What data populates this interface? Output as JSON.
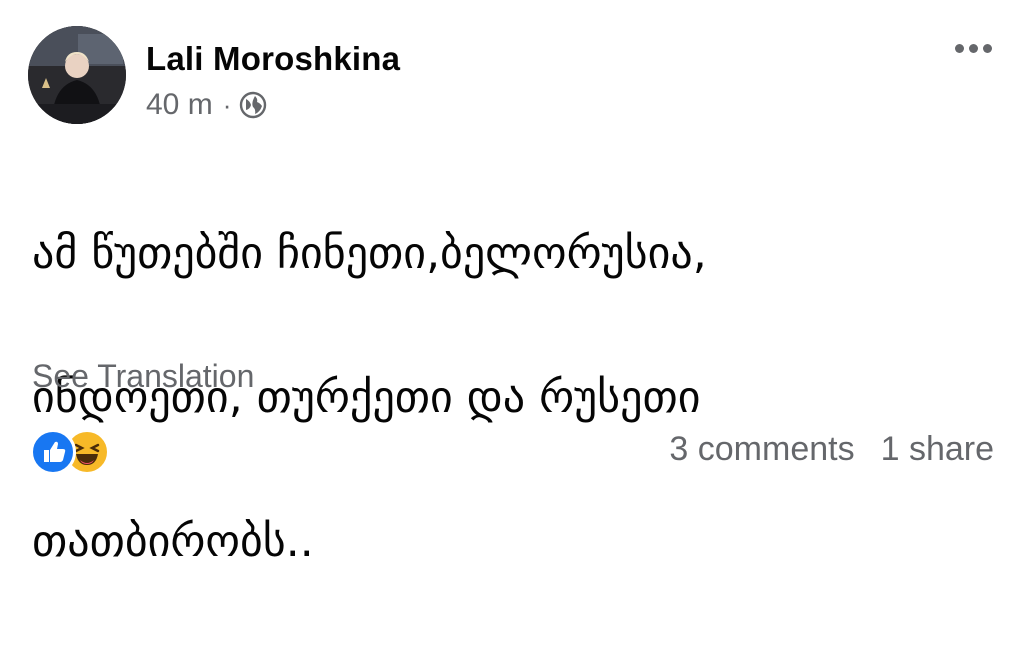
{
  "post": {
    "author": "Lali Moroshkina",
    "time": "40 m",
    "separator": "·",
    "audience_icon": "globe-icon",
    "text_lines": [
      "ამ წუთებში  ჩინეთი,ბელორუსია,",
      "ინდოეთი, თურქეთი და რუსეთი",
      "თათბირობს.."
    ],
    "see_translation": "See Translation"
  },
  "footer": {
    "reactions": [
      "like-icon",
      "haha-icon"
    ],
    "comments": "3 comments",
    "shares": "1 share"
  },
  "colors": {
    "text": "#050505",
    "secondary": "#65676b",
    "like_blue": "#1877f2",
    "haha_yellow": "#f7b928"
  }
}
